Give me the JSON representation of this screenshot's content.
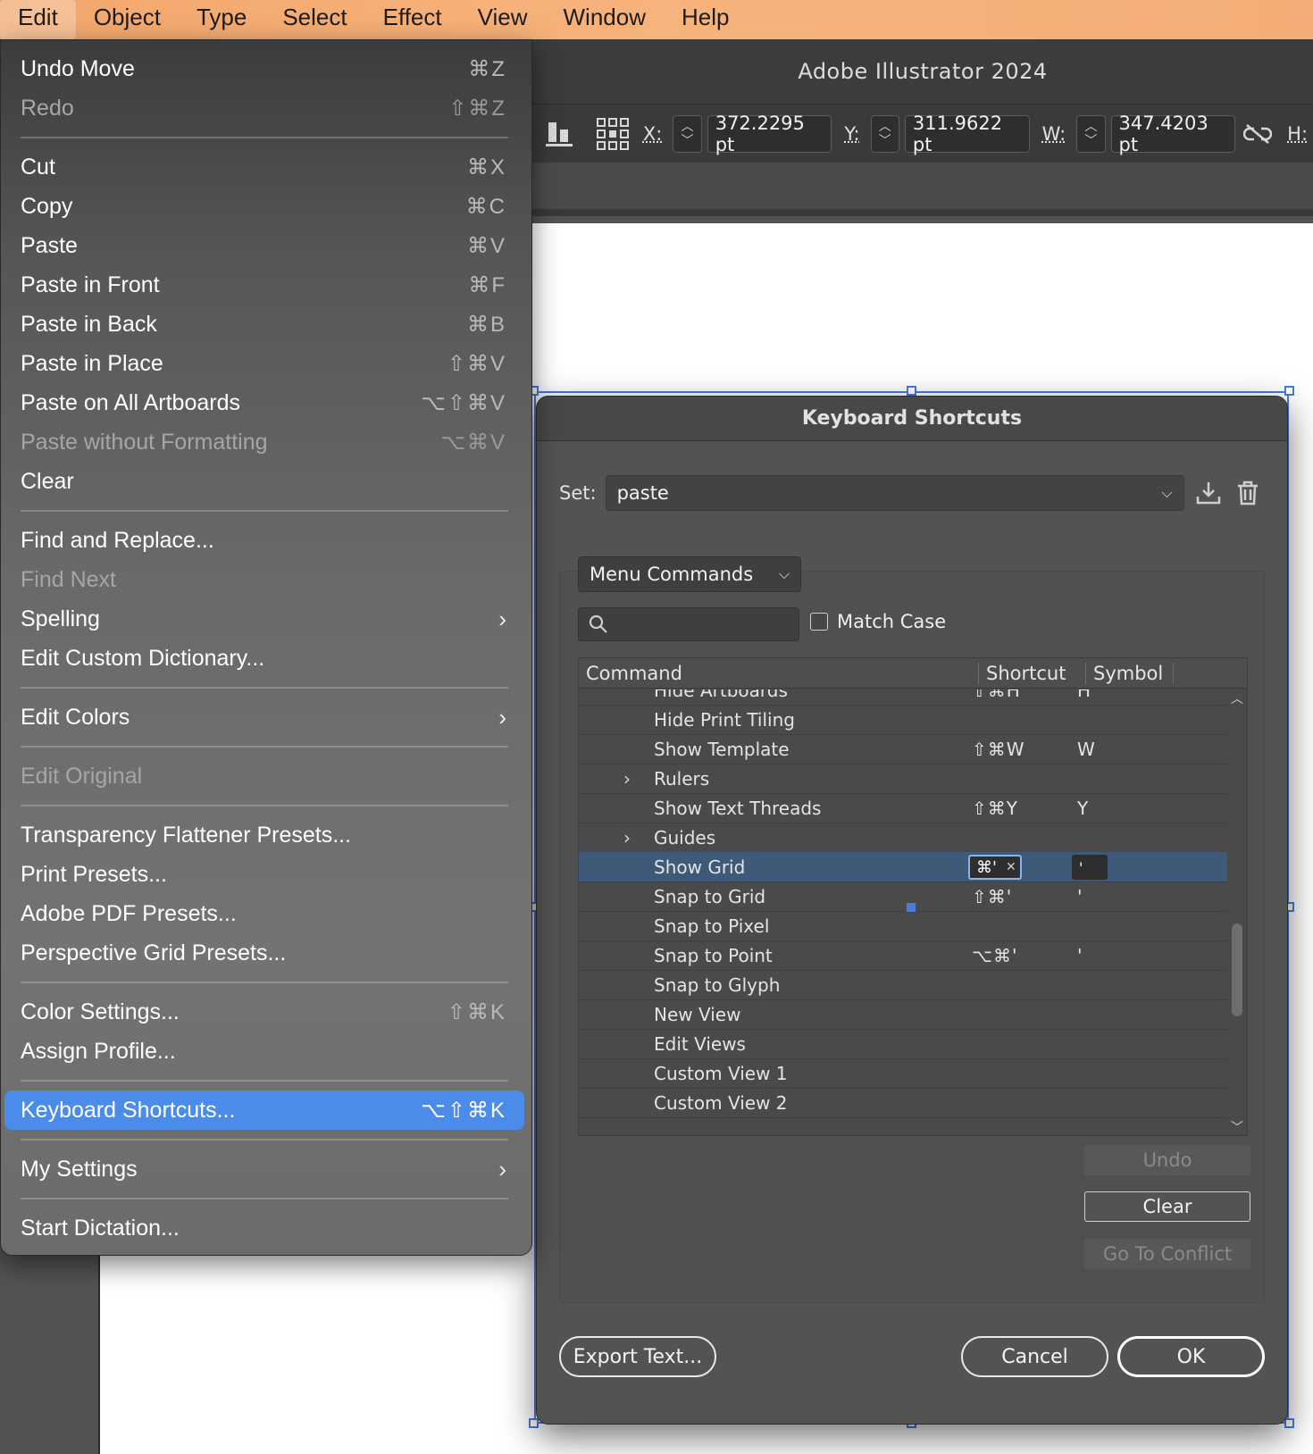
{
  "menubar": {
    "items": [
      {
        "label": "Edit",
        "active": true
      },
      {
        "label": "Object"
      },
      {
        "label": "Type"
      },
      {
        "label": "Select"
      },
      {
        "label": "Effect"
      },
      {
        "label": "View"
      },
      {
        "label": "Window"
      },
      {
        "label": "Help"
      }
    ]
  },
  "app": {
    "title": "Adobe Illustrator 2024",
    "control": {
      "x_label": "X:",
      "x_value": "372.2295 pt",
      "y_label": "Y:",
      "y_value": "311.9622 pt",
      "w_label": "W:",
      "w_value": "347.4203 pt",
      "h_label": "H:"
    }
  },
  "edit_menu": {
    "items": [
      {
        "type": "item",
        "label": "Undo Move",
        "shortcut": "⌘Z"
      },
      {
        "type": "item",
        "label": "Redo",
        "shortcut": "⇧⌘Z",
        "disabled": true
      },
      {
        "type": "sep"
      },
      {
        "type": "item",
        "label": "Cut",
        "shortcut": "⌘X"
      },
      {
        "type": "item",
        "label": "Copy",
        "shortcut": "⌘C"
      },
      {
        "type": "item",
        "label": "Paste",
        "shortcut": "⌘V"
      },
      {
        "type": "item",
        "label": "Paste in Front",
        "shortcut": "⌘F"
      },
      {
        "type": "item",
        "label": "Paste in Back",
        "shortcut": "⌘B"
      },
      {
        "type": "item",
        "label": "Paste in Place",
        "shortcut": "⇧⌘V"
      },
      {
        "type": "item",
        "label": "Paste on All Artboards",
        "shortcut": "⌥⇧⌘V"
      },
      {
        "type": "item",
        "label": "Paste without Formatting",
        "shortcut": "⌥⌘V",
        "disabled": true
      },
      {
        "type": "item",
        "label": "Clear",
        "shortcut": ""
      },
      {
        "type": "sep"
      },
      {
        "type": "item",
        "label": "Find and Replace...",
        "shortcut": ""
      },
      {
        "type": "item",
        "label": "Find Next",
        "shortcut": "",
        "disabled": true
      },
      {
        "type": "item",
        "label": "Spelling",
        "shortcut": "",
        "submenu": true
      },
      {
        "type": "item",
        "label": "Edit Custom Dictionary...",
        "shortcut": ""
      },
      {
        "type": "sep"
      },
      {
        "type": "item",
        "label": "Edit Colors",
        "shortcut": "",
        "submenu": true
      },
      {
        "type": "sep"
      },
      {
        "type": "item",
        "label": "Edit Original",
        "shortcut": "",
        "disabled": true
      },
      {
        "type": "sep"
      },
      {
        "type": "item",
        "label": "Transparency Flattener Presets...",
        "shortcut": ""
      },
      {
        "type": "item",
        "label": "Print Presets...",
        "shortcut": ""
      },
      {
        "type": "item",
        "label": "Adobe PDF Presets...",
        "shortcut": ""
      },
      {
        "type": "item",
        "label": "Perspective Grid Presets...",
        "shortcut": ""
      },
      {
        "type": "sep"
      },
      {
        "type": "item",
        "label": "Color Settings...",
        "shortcut": "⇧⌘K"
      },
      {
        "type": "item",
        "label": "Assign Profile...",
        "shortcut": ""
      },
      {
        "type": "sep"
      },
      {
        "type": "item",
        "label": "Keyboard Shortcuts...",
        "shortcut": "⌥⇧⌘K",
        "highlighted": true
      },
      {
        "type": "sep"
      },
      {
        "type": "item",
        "label": "My Settings",
        "shortcut": "",
        "submenu": true
      },
      {
        "type": "sep"
      },
      {
        "type": "item",
        "label": "Start Dictation...",
        "shortcut": ""
      }
    ]
  },
  "dialog": {
    "title": "Keyboard Shortcuts",
    "set_label": "Set:",
    "set_value": "paste",
    "mode_value": "Menu Commands",
    "search_value": "",
    "match_case_label": "Match Case",
    "columns": {
      "command": "Command",
      "shortcut": "Shortcut",
      "symbol": "Symbol"
    },
    "rows": [
      {
        "command": "Hide Artboards",
        "shortcut": "⇧⌘H",
        "symbol": "H",
        "expandable": false
      },
      {
        "command": "Hide Print Tiling",
        "shortcut": "",
        "symbol": "",
        "expandable": false
      },
      {
        "command": "Show Template",
        "shortcut": "⇧⌘W",
        "symbol": "W",
        "expandable": false
      },
      {
        "command": "Rulers",
        "shortcut": "",
        "symbol": "",
        "expandable": true
      },
      {
        "command": "Show Text Threads",
        "shortcut": "⇧⌘Y",
        "symbol": "Y",
        "expandable": false
      },
      {
        "command": "Guides",
        "shortcut": "",
        "symbol": "",
        "expandable": true
      },
      {
        "command": "Show Grid",
        "shortcut": "⌘'",
        "symbol": "'",
        "expandable": false,
        "selected": true
      },
      {
        "command": "Snap to Grid",
        "shortcut": "⇧⌘'",
        "symbol": "'",
        "expandable": false
      },
      {
        "command": "Snap to Pixel",
        "shortcut": "",
        "symbol": "",
        "expandable": false
      },
      {
        "command": "Snap to Point",
        "shortcut": "⌥⌘'",
        "symbol": "'",
        "expandable": false
      },
      {
        "command": "Snap to Glyph",
        "shortcut": "",
        "symbol": "",
        "expandable": false
      },
      {
        "command": "New View",
        "shortcut": "",
        "symbol": "",
        "expandable": false
      },
      {
        "command": "Edit Views",
        "shortcut": "",
        "symbol": "",
        "expandable": false
      },
      {
        "command": "Custom View 1",
        "shortcut": "",
        "symbol": "",
        "expandable": false
      },
      {
        "command": "Custom View 2",
        "shortcut": "",
        "symbol": "",
        "expandable": false
      }
    ],
    "buttons": {
      "undo": "Undo",
      "clear": "Clear",
      "go_to_conflict": "Go To Conflict",
      "export_text": "Export Text...",
      "cancel": "Cancel",
      "ok": "OK"
    }
  },
  "colors": {
    "menubar": "#f7b37c",
    "highlight": "#4b8bea",
    "selection": "#4a7bd8",
    "selected_row": "#3e5a78"
  }
}
